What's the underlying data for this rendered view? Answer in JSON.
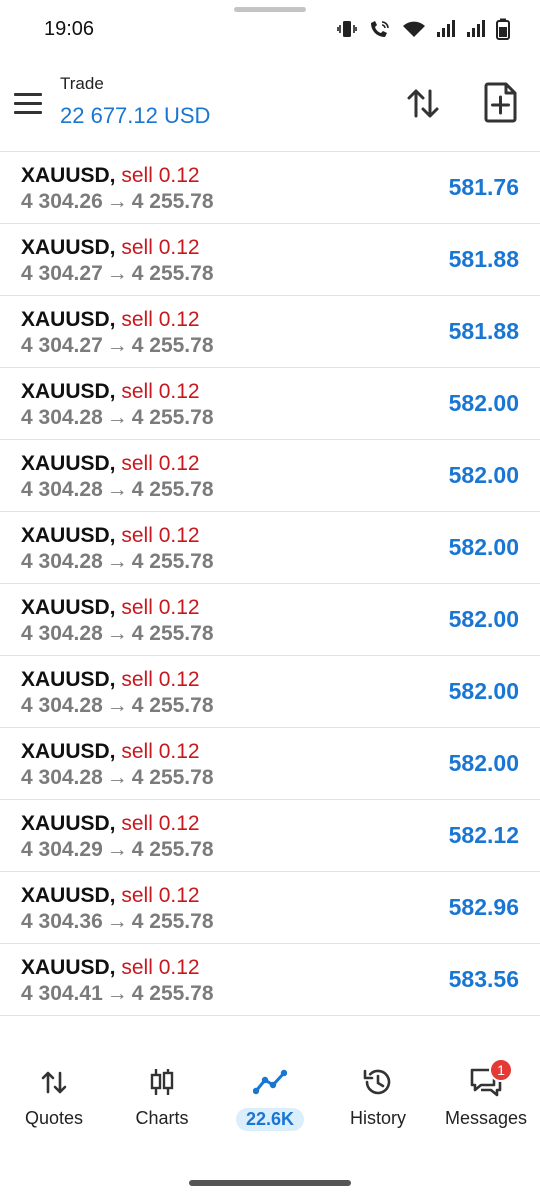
{
  "status": {
    "time": "19:06"
  },
  "header": {
    "title": "Trade",
    "balance": "22 677.12 USD"
  },
  "positions": [
    {
      "symbol": "XAUUSD,",
      "side": "sell 0.12",
      "open": "4 304.26",
      "current": "4 255.78",
      "profit": "581.76"
    },
    {
      "symbol": "XAUUSD,",
      "side": "sell 0.12",
      "open": "4 304.27",
      "current": "4 255.78",
      "profit": "581.88"
    },
    {
      "symbol": "XAUUSD,",
      "side": "sell 0.12",
      "open": "4 304.27",
      "current": "4 255.78",
      "profit": "581.88"
    },
    {
      "symbol": "XAUUSD,",
      "side": "sell 0.12",
      "open": "4 304.28",
      "current": "4 255.78",
      "profit": "582.00"
    },
    {
      "symbol": "XAUUSD,",
      "side": "sell 0.12",
      "open": "4 304.28",
      "current": "4 255.78",
      "profit": "582.00"
    },
    {
      "symbol": "XAUUSD,",
      "side": "sell 0.12",
      "open": "4 304.28",
      "current": "4 255.78",
      "profit": "582.00"
    },
    {
      "symbol": "XAUUSD,",
      "side": "sell 0.12",
      "open": "4 304.28",
      "current": "4 255.78",
      "profit": "582.00"
    },
    {
      "symbol": "XAUUSD,",
      "side": "sell 0.12",
      "open": "4 304.28",
      "current": "4 255.78",
      "profit": "582.00"
    },
    {
      "symbol": "XAUUSD,",
      "side": "sell 0.12",
      "open": "4 304.28",
      "current": "4 255.78",
      "profit": "582.00"
    },
    {
      "symbol": "XAUUSD,",
      "side": "sell 0.12",
      "open": "4 304.29",
      "current": "4 255.78",
      "profit": "582.12"
    },
    {
      "symbol": "XAUUSD,",
      "side": "sell 0.12",
      "open": "4 304.36",
      "current": "4 255.78",
      "profit": "582.96"
    },
    {
      "symbol": "XAUUSD,",
      "side": "sell 0.12",
      "open": "4 304.41",
      "current": "4 255.78",
      "profit": "583.56"
    }
  ],
  "arrow": "→",
  "nav": {
    "quotes": "Quotes",
    "charts": "Charts",
    "trade": "22.6K",
    "history": "History",
    "messages": "Messages",
    "messages_badge": "1"
  },
  "colors": {
    "accent": "#1976d2",
    "sell": "#c8181e",
    "muted": "#7b7b7b",
    "badge": "#e53935"
  }
}
